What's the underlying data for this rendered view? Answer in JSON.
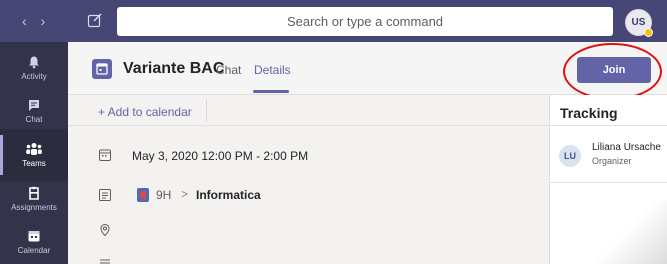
{
  "topbar": {
    "search_placeholder": "Search or type a command",
    "avatar_initials": "US",
    "back_icon": "chevron-left-icon",
    "forward_icon": "chevron-right-icon",
    "compose_icon": "compose-icon"
  },
  "rail": {
    "items": [
      {
        "label": "Activity",
        "icon": "bell-icon"
      },
      {
        "label": "Chat",
        "icon": "chat-icon"
      },
      {
        "label": "Teams",
        "icon": "teams-icon",
        "active": true
      },
      {
        "label": "Assignments",
        "icon": "assignments-icon"
      },
      {
        "label": "Calendar",
        "icon": "calendar-icon"
      }
    ]
  },
  "header": {
    "title": "Variante BAC",
    "tabs": [
      {
        "label": "Chat"
      },
      {
        "label": "Details",
        "active": true
      }
    ],
    "join_label": "Join"
  },
  "toolbar": {
    "add_calendar_label": "+ Add to calendar"
  },
  "details": {
    "datetime": "May 3, 2020 12:00 PM - 2:00 PM",
    "channel": {
      "team": "9H",
      "separator": ">",
      "name": "Informatica"
    }
  },
  "tracking": {
    "title": "Tracking",
    "attendees": [
      {
        "initials": "LU",
        "name": "Liliana Ursache",
        "role": "Organizer"
      }
    ]
  },
  "colors": {
    "brand": "#6264a7",
    "topbar": "#464775",
    "rail": "#33344a",
    "annotation_circle": "#e01010"
  }
}
